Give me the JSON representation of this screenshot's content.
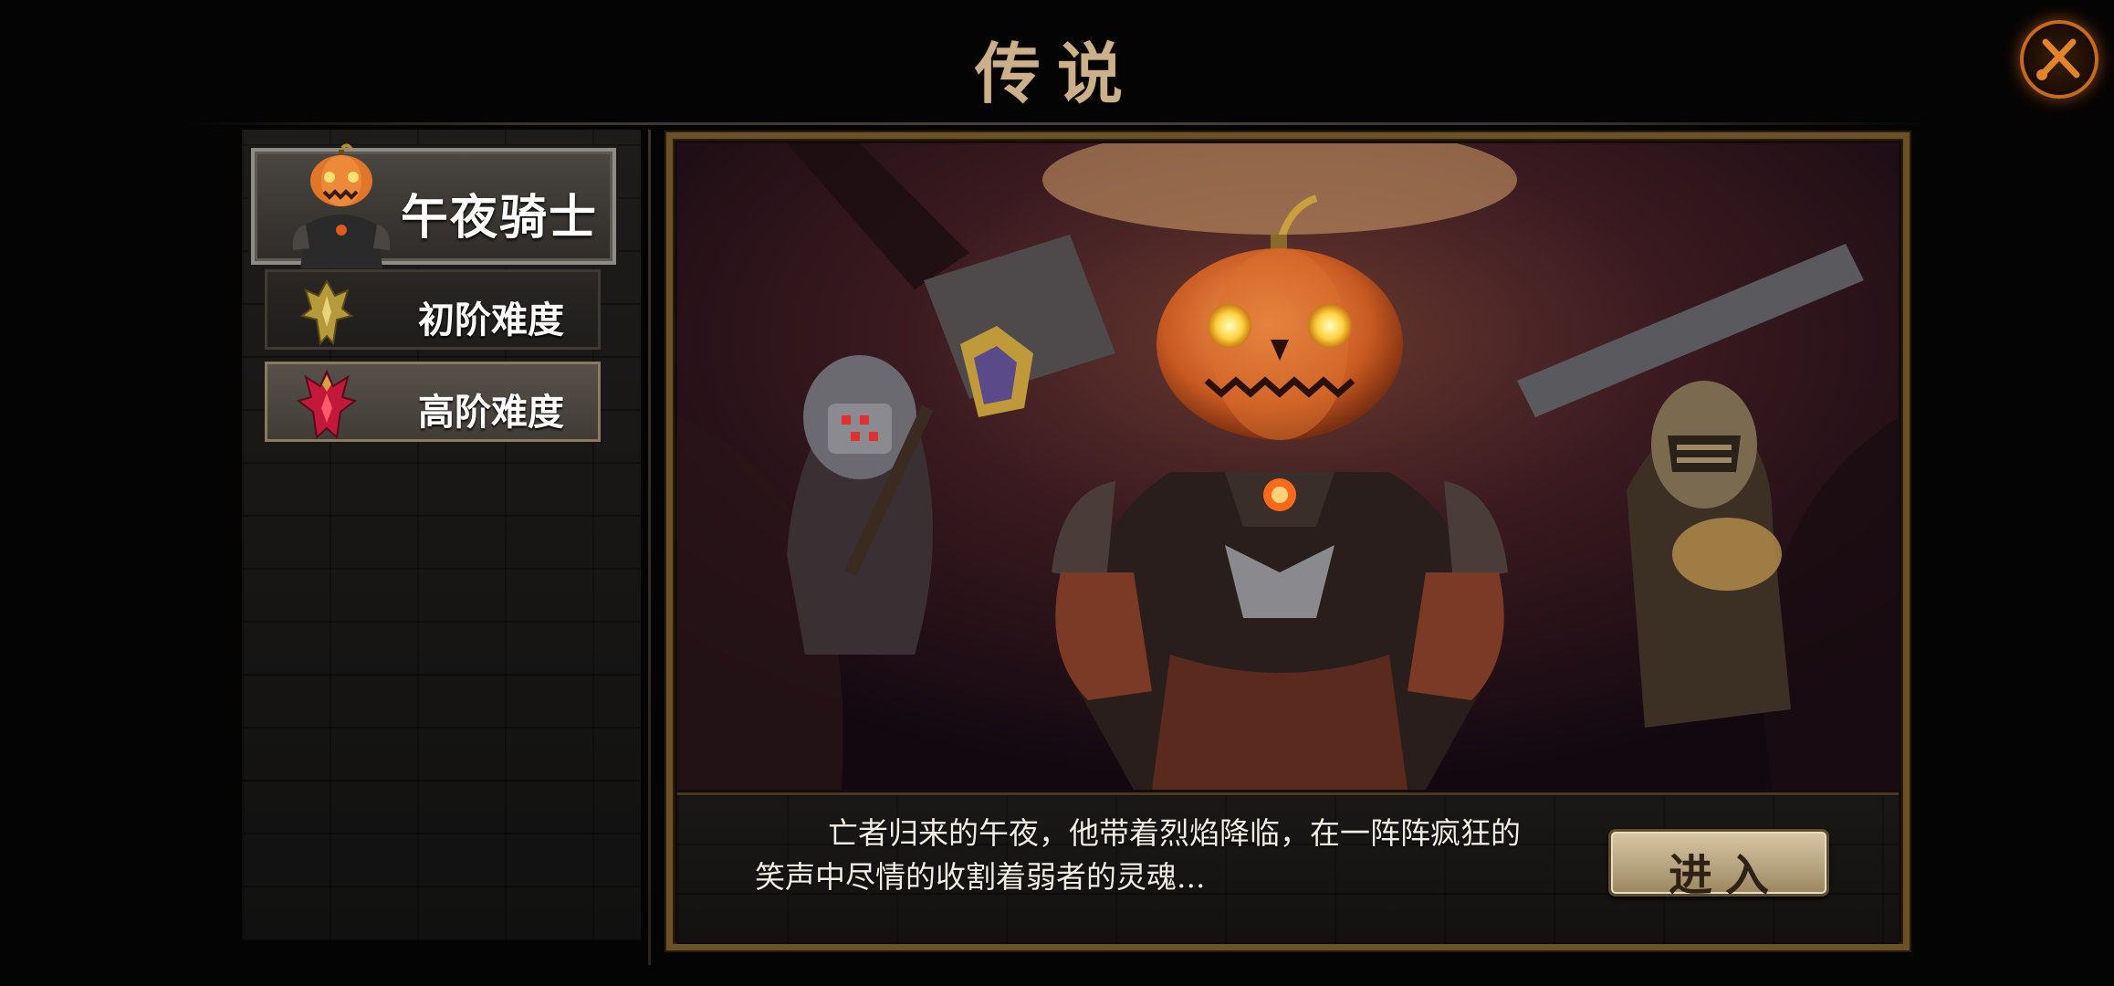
{
  "header": {
    "title": "传说",
    "close_icon": "close-x-icon"
  },
  "sidebar": {
    "boss": {
      "name": "午夜骑士",
      "portrait_icon": "pumpkin-knight-portrait"
    },
    "difficulties": [
      {
        "label": "初阶难度",
        "icon": "gold-crest-icon",
        "selected": false
      },
      {
        "label": "高阶难度",
        "icon": "red-flame-crest-icon",
        "selected": true
      }
    ]
  },
  "scene": {
    "art": "pumpkin-knight-scene",
    "description": "亡者归来的午夜，他带着烈焰降临，在一阵阵疯狂的笑声中尽情的收割着弱者的灵魂...",
    "enter_label": "进入"
  },
  "colors": {
    "title": "#cbb08b",
    "frame_border": "#6b5127",
    "accent_orange": "#c86a1c",
    "button_bg": "#c9b893"
  }
}
